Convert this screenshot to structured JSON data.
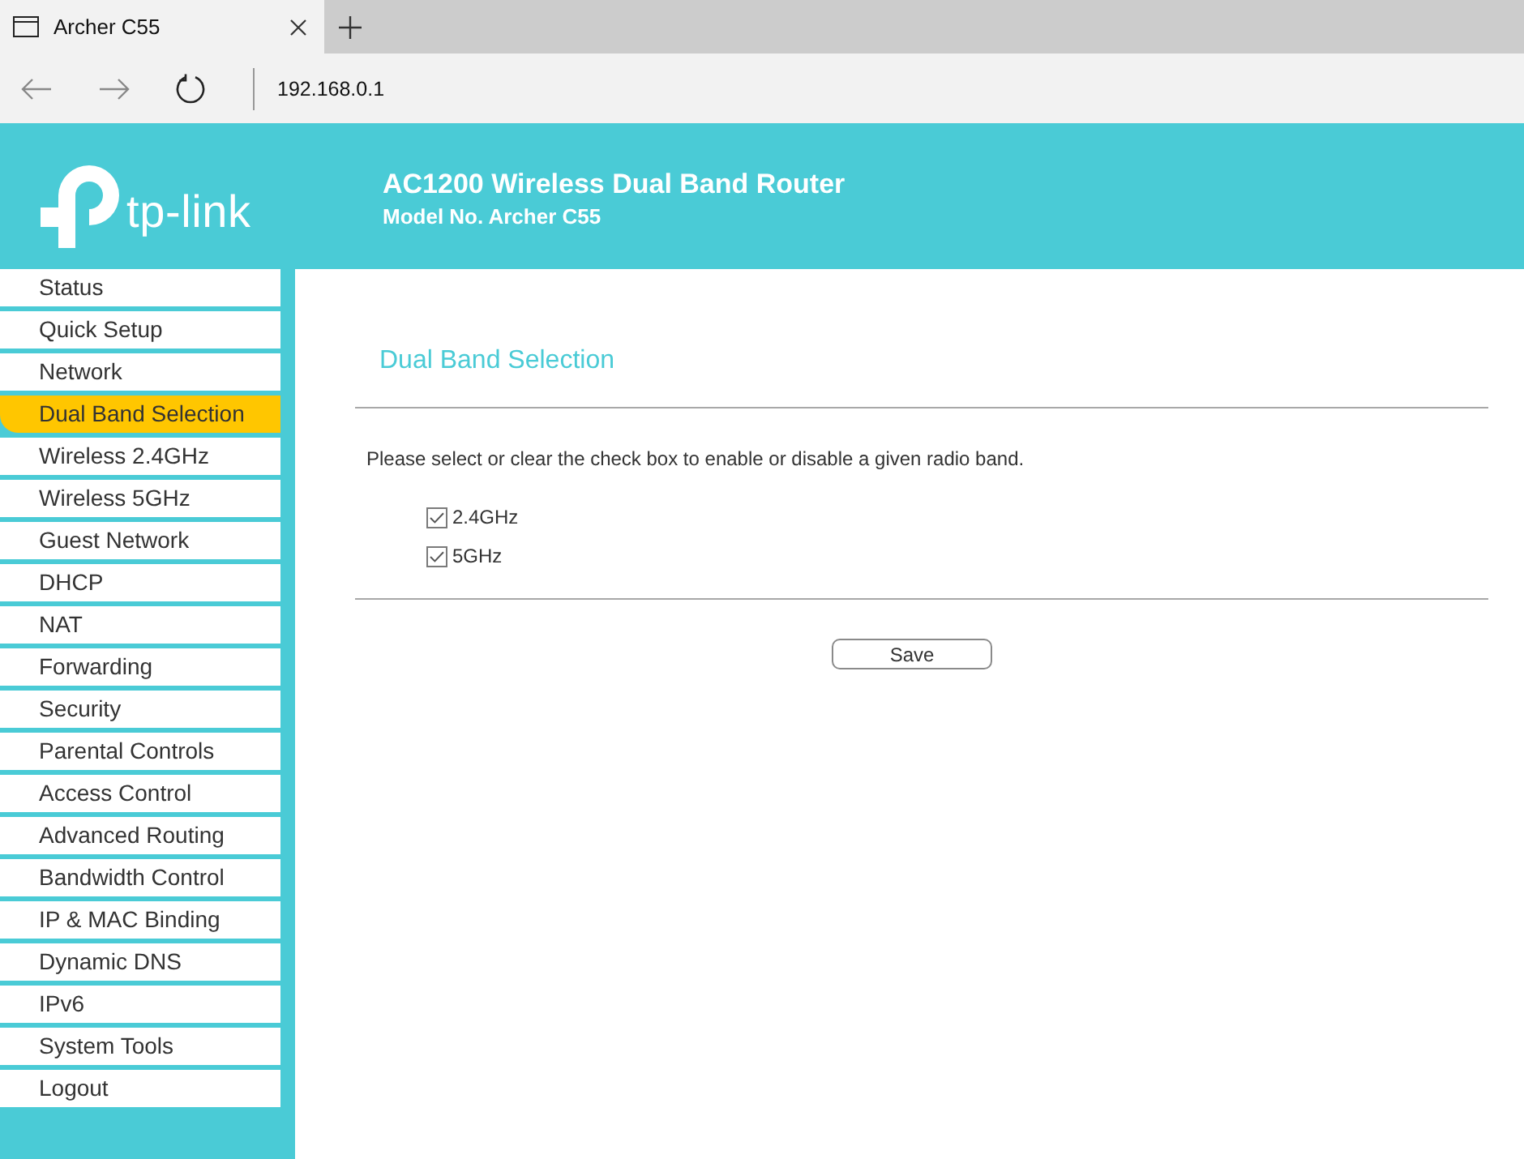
{
  "browser": {
    "tab": {
      "title": "Archer C55"
    },
    "address": "192.168.0.1"
  },
  "header": {
    "logo_text": "tp-link",
    "title": "AC1200 Wireless Dual Band Router",
    "model": "Model No. Archer C55"
  },
  "sidebar": {
    "items": [
      {
        "label": "Status",
        "selected": false
      },
      {
        "label": "Quick Setup",
        "selected": false
      },
      {
        "label": "Network",
        "selected": false
      },
      {
        "label": "Dual Band Selection",
        "selected": true
      },
      {
        "label": "Wireless 2.4GHz",
        "selected": false
      },
      {
        "label": "Wireless 5GHz",
        "selected": false
      },
      {
        "label": "Guest Network",
        "selected": false
      },
      {
        "label": "DHCP",
        "selected": false
      },
      {
        "label": "NAT",
        "selected": false
      },
      {
        "label": "Forwarding",
        "selected": false
      },
      {
        "label": "Security",
        "selected": false
      },
      {
        "label": "Parental Controls",
        "selected": false
      },
      {
        "label": "Access Control",
        "selected": false
      },
      {
        "label": "Advanced Routing",
        "selected": false
      },
      {
        "label": "Bandwidth Control",
        "selected": false
      },
      {
        "label": "IP & MAC Binding",
        "selected": false
      },
      {
        "label": "Dynamic DNS",
        "selected": false
      },
      {
        "label": "IPv6",
        "selected": false
      },
      {
        "label": "System Tools",
        "selected": false
      },
      {
        "label": "Logout",
        "selected": false
      }
    ]
  },
  "content": {
    "title": "Dual Band Selection",
    "instruction": "Please select or clear the check box to enable or disable a given radio band.",
    "bands": [
      {
        "label": "2.4GHz",
        "checked": true
      },
      {
        "label": "5GHz",
        "checked": true
      }
    ],
    "save_button": "Save"
  }
}
